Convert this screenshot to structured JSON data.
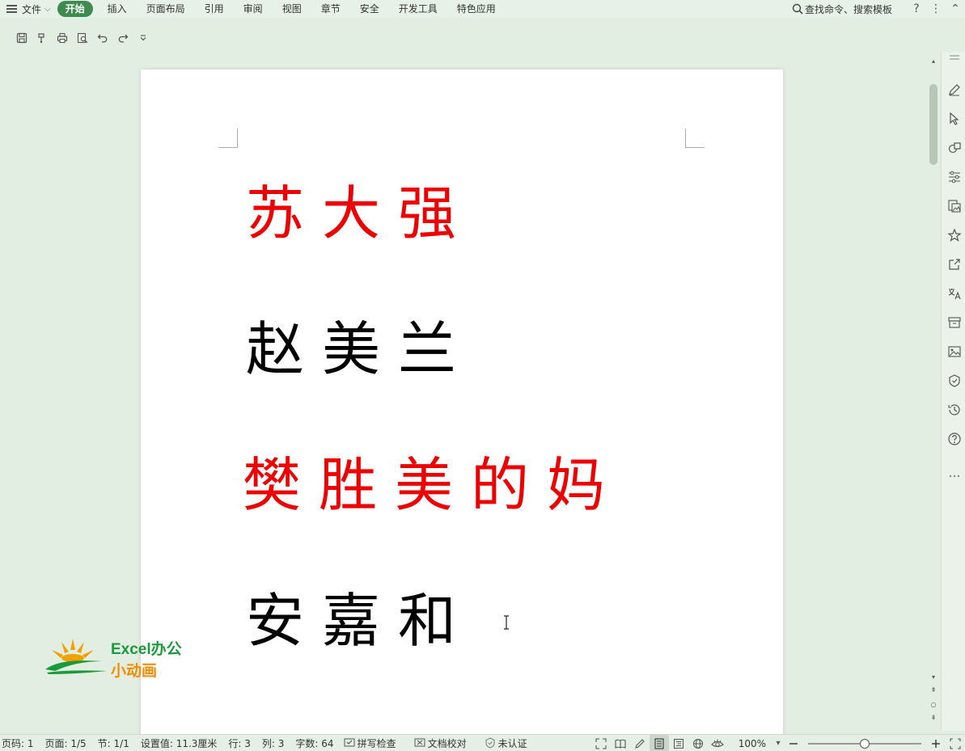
{
  "menubar": {
    "file_label": "文件",
    "tabs": [
      "开始",
      "插入",
      "页面布局",
      "引用",
      "审阅",
      "视图",
      "章节",
      "安全",
      "开发工具",
      "特色应用"
    ],
    "active_tab": "开始",
    "search_label": "查找命令、搜索模板",
    "help_icon": "help-icon",
    "more_icon": "more-vertical-icon",
    "collapse_icon": "chevron-up-icon"
  },
  "quick_access": {
    "icons": [
      "save-icon",
      "format-painter-icon",
      "print-icon",
      "print-preview-icon",
      "undo-icon",
      "redo-icon",
      "customize-dropdown-icon"
    ]
  },
  "document": {
    "lines": [
      {
        "text": "苏大强",
        "color": "#ee0000"
      },
      {
        "text": "赵美兰",
        "color": "#000000"
      },
      {
        "text": "樊胜美的妈",
        "color": "#ee0000"
      },
      {
        "text": "安嘉和",
        "color": "#000000"
      }
    ]
  },
  "logo": {
    "line1": "Excel办公",
    "line2": "小动画",
    "primary_color": "#1a9a3a",
    "secondary_color": "#f28c00"
  },
  "statusbar": {
    "page_num": "页码: 1",
    "pages": "页面: 1/5",
    "section": "节: 1/1",
    "setting": "设置值: 11.3厘米",
    "row": "行: 3",
    "col": "列: 3",
    "word_count": "字数: 64",
    "spell_check": "拼写检查",
    "doc_proof": "文档校对",
    "certification": "未认证",
    "zoom": "100%",
    "zoom_level_percent": 100
  },
  "colors": {
    "accent": "#3f8a4f",
    "background": "#e3eee3"
  }
}
